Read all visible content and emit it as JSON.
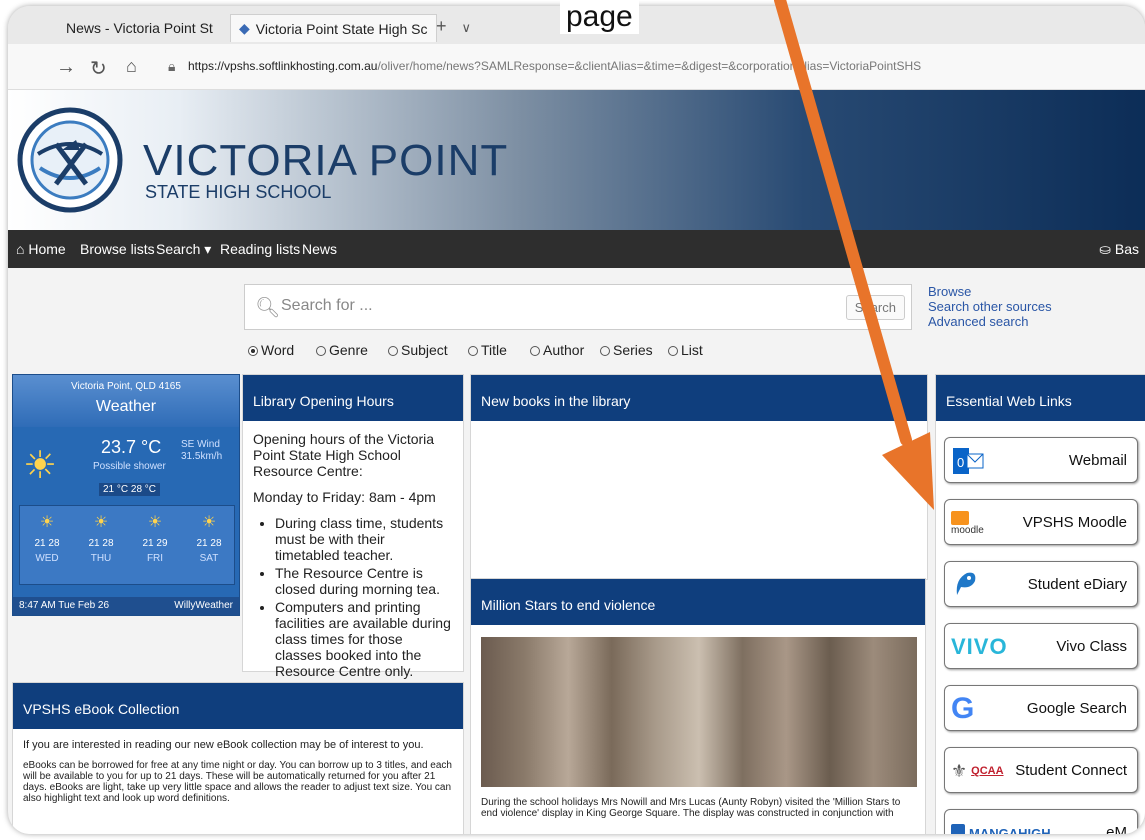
{
  "caption_text": "page",
  "browser": {
    "tabs": [
      {
        "label": "News - Victoria Point St",
        "active": true
      },
      {
        "label": "Victoria Point State High Sc",
        "active": false
      }
    ],
    "new_tab_symbol": "+",
    "tab_menu_symbol": "∨",
    "url_host": "https://vpshs.softlinkhosting.com.au",
    "url_path": "/oliver/home/news?SAMLResponse=&clientAlias=&time=&digest=&corporationAlias=VictoriaPointSHS"
  },
  "banner": {
    "title": "VICTORIA POINT",
    "subtitle": "STATE HIGH SCHOOL"
  },
  "nav": {
    "home": "Home",
    "browse": "Browse lists",
    "search": "Search ▾",
    "reading": "Reading lists",
    "news": "News",
    "basket": "Bas"
  },
  "search": {
    "placeholder": "Search for ...",
    "button": "Search",
    "links": [
      "Browse",
      "Search other sources",
      "Advanced search"
    ],
    "options": [
      "Word",
      "Genre",
      "Subject",
      "Title",
      "Author",
      "Series",
      "List"
    ],
    "selected": "Word"
  },
  "weather": {
    "location": "Victoria Point, QLD 4165",
    "title": "Weather",
    "temp": "23.7 °C",
    "condition": "Possible shower",
    "wind_dir": "SE Wind",
    "wind_speed": "31.5km/h",
    "range": "21 °C  28 °C",
    "days": [
      {
        "low": "21",
        "high": "28",
        "day": "WED"
      },
      {
        "low": "21",
        "high": "28",
        "day": "THU"
      },
      {
        "low": "21",
        "high": "29",
        "day": "FRI"
      },
      {
        "low": "21",
        "high": "28",
        "day": "SAT"
      }
    ],
    "time": "8:47 AM Tue Feb 26",
    "brand": "WillyWeather"
  },
  "hours": {
    "title": "Library Opening Hours",
    "intro": "Opening hours of the Victoria Point State High School Resource Centre:",
    "weekday": "Monday to Friday:  8am - 4pm",
    "bullets": [
      "During class time, students must be with their timetabled teacher.",
      "The Resource Centre is closed during morning tea.",
      "Computers and printing facilities are available during class times for those classes booked into the Resource Centre only."
    ]
  },
  "new_books": {
    "title": "New books in the library"
  },
  "million": {
    "title": "Million Stars to end violence",
    "text": "During the school holidays Mrs Nowill and Mrs Lucas (Aunty Robyn) visited the 'Million Stars to end violence' display in King George Square. The display was constructed in conjunction with"
  },
  "ebook": {
    "title": "VPSHS eBook Collection",
    "p1": "If you are interested in reading our new eBook collection may be of interest to you.",
    "p2": "eBooks can be borrowed for free at any time night or day.  You can borrow up to 3 titles, and each will be available to you for up to 21 days.  These will be automatically returned for you after 21 days. eBooks are light, take up very little space and allows the reader to adjust text size. You can also highlight text and look up word definitions."
  },
  "links": {
    "title": "Essential Web Links",
    "items": [
      {
        "label": "Webmail",
        "icon": "outlook-icon"
      },
      {
        "label": "VPSHS Moodle",
        "icon": "moodle-icon",
        "icon_text": "moodle"
      },
      {
        "label": "Student eDiary",
        "icon": "ediary-icon"
      },
      {
        "label": "Vivo Class",
        "icon": "vivo-icon",
        "icon_text": "VIVO"
      },
      {
        "label": "Google Search",
        "icon": "google-icon",
        "icon_text": "G"
      },
      {
        "label": "Student Connect",
        "icon": "qcaa-icon",
        "icon_text": "QCAA"
      },
      {
        "label": "eM",
        "icon": "mangahigh-icon",
        "icon_text": "MANGAHIGH"
      }
    ]
  },
  "colors": {
    "panel_header": "#0f3e7d",
    "nav_bg": "#2e2e2e",
    "arrow": "#e8742a"
  }
}
